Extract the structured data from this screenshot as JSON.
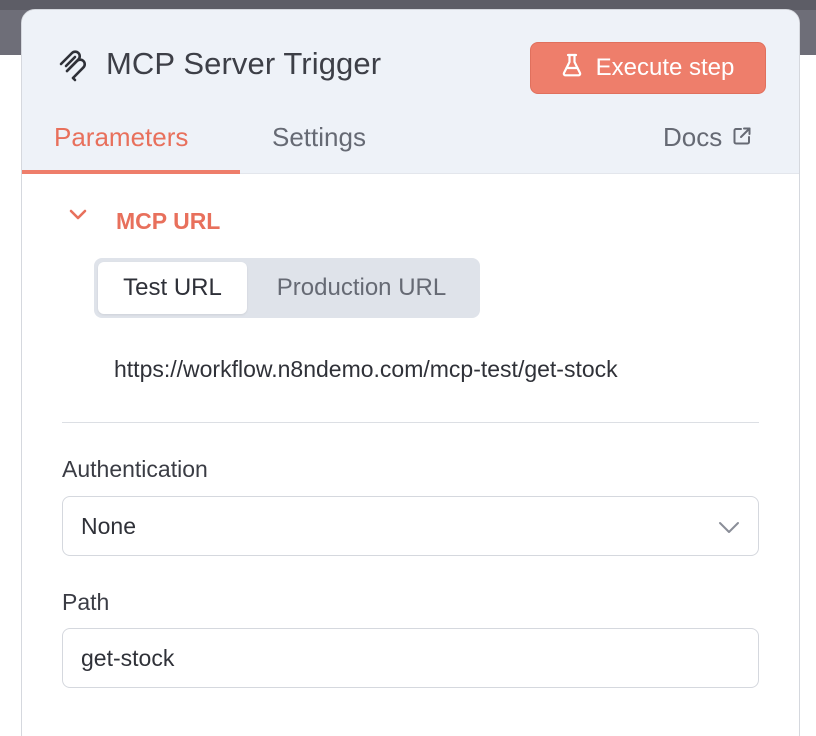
{
  "node": {
    "title": "MCP Server Trigger",
    "icon": "mcp-icon",
    "execute_label": "Execute step",
    "execute_icon": "flask-icon",
    "accent_color": "#ee7e6b"
  },
  "tabs": [
    {
      "label": "Parameters",
      "active": true
    },
    {
      "label": "Settings",
      "active": false
    },
    {
      "label": "Docs",
      "icon": "external-link-icon",
      "active": false
    }
  ],
  "mcp_section": {
    "title": "MCP URL",
    "expanded": true,
    "url_toggle": {
      "options": [
        "Test URL",
        "Production URL"
      ],
      "selected": "Test URL"
    },
    "url": "https://workflow.n8ndemo.com/mcp-test/get-stock"
  },
  "authentication": {
    "label": "Authentication",
    "value": "None"
  },
  "path": {
    "label": "Path",
    "value": "get-stock"
  }
}
